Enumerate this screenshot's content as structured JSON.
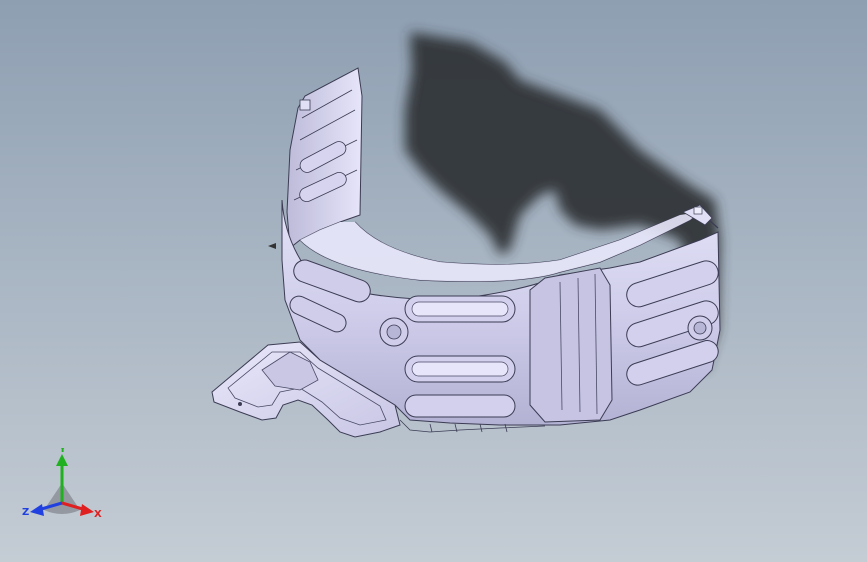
{
  "viewport": {
    "background_top": "#8e9fb2",
    "background_bottom": "#c4ccd4",
    "part_color": "#d9d8f2",
    "edge_color": "#3c3c54",
    "shadow_color": "#2e3136"
  },
  "triad": {
    "x_label": "X",
    "y_label": "Y",
    "z_label": "Z",
    "x_color": "#e02020",
    "y_color": "#20b020",
    "z_color": "#2040e0"
  }
}
